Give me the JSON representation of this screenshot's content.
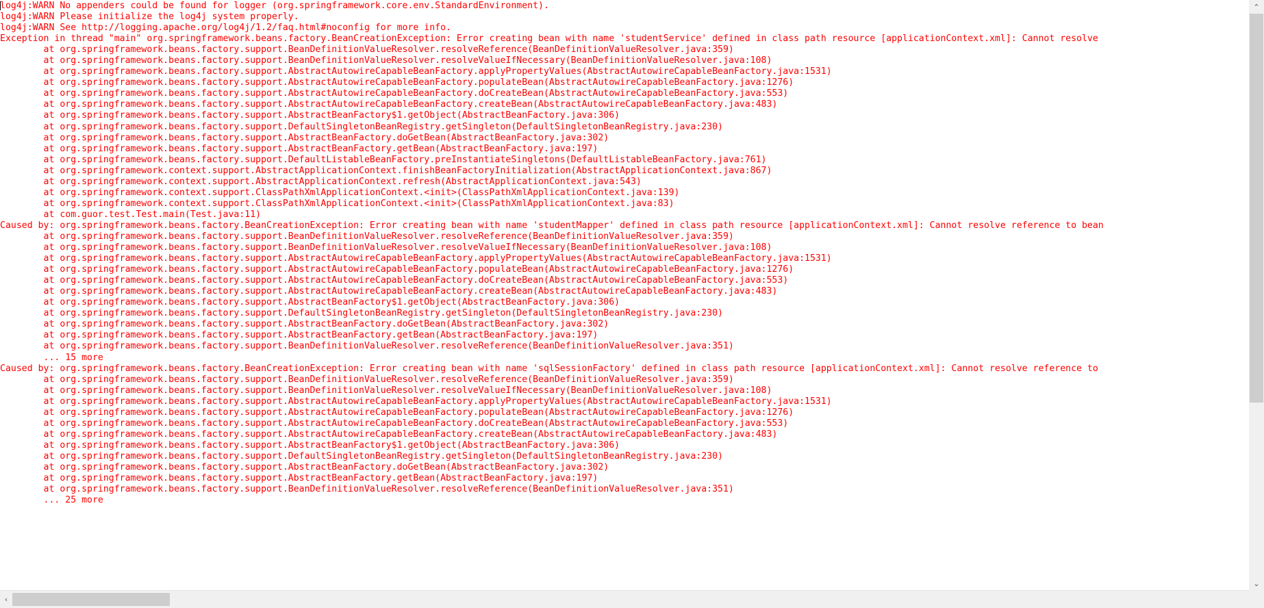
{
  "console": {
    "text_color": "#fe0000",
    "background_color": "#ffffff",
    "lines": [
      "log4j:WARN No appenders could be found for logger (org.springframework.core.env.StandardEnvironment).",
      "log4j:WARN Please initialize the log4j system properly.",
      "log4j:WARN See http://logging.apache.org/log4j/1.2/faq.html#noconfig for more info.",
      "Exception in thread \"main\" org.springframework.beans.factory.BeanCreationException: Error creating bean with name 'studentService' defined in class path resource [applicationContext.xml]: Cannot resolve",
      "\tat org.springframework.beans.factory.support.BeanDefinitionValueResolver.resolveReference(BeanDefinitionValueResolver.java:359)",
      "\tat org.springframework.beans.factory.support.BeanDefinitionValueResolver.resolveValueIfNecessary(BeanDefinitionValueResolver.java:108)",
      "\tat org.springframework.beans.factory.support.AbstractAutowireCapableBeanFactory.applyPropertyValues(AbstractAutowireCapableBeanFactory.java:1531)",
      "\tat org.springframework.beans.factory.support.AbstractAutowireCapableBeanFactory.populateBean(AbstractAutowireCapableBeanFactory.java:1276)",
      "\tat org.springframework.beans.factory.support.AbstractAutowireCapableBeanFactory.doCreateBean(AbstractAutowireCapableBeanFactory.java:553)",
      "\tat org.springframework.beans.factory.support.AbstractAutowireCapableBeanFactory.createBean(AbstractAutowireCapableBeanFactory.java:483)",
      "\tat org.springframework.beans.factory.support.AbstractBeanFactory$1.getObject(AbstractBeanFactory.java:306)",
      "\tat org.springframework.beans.factory.support.DefaultSingletonBeanRegistry.getSingleton(DefaultSingletonBeanRegistry.java:230)",
      "\tat org.springframework.beans.factory.support.AbstractBeanFactory.doGetBean(AbstractBeanFactory.java:302)",
      "\tat org.springframework.beans.factory.support.AbstractBeanFactory.getBean(AbstractBeanFactory.java:197)",
      "\tat org.springframework.beans.factory.support.DefaultListableBeanFactory.preInstantiateSingletons(DefaultListableBeanFactory.java:761)",
      "\tat org.springframework.context.support.AbstractApplicationContext.finishBeanFactoryInitialization(AbstractApplicationContext.java:867)",
      "\tat org.springframework.context.support.AbstractApplicationContext.refresh(AbstractApplicationContext.java:543)",
      "\tat org.springframework.context.support.ClassPathXmlApplicationContext.<init>(ClassPathXmlApplicationContext.java:139)",
      "\tat org.springframework.context.support.ClassPathXmlApplicationContext.<init>(ClassPathXmlApplicationContext.java:83)",
      "\tat com.guor.test.Test.main(Test.java:11)",
      "Caused by: org.springframework.beans.factory.BeanCreationException: Error creating bean with name 'studentMapper' defined in class path resource [applicationContext.xml]: Cannot resolve reference to bean",
      "\tat org.springframework.beans.factory.support.BeanDefinitionValueResolver.resolveReference(BeanDefinitionValueResolver.java:359)",
      "\tat org.springframework.beans.factory.support.BeanDefinitionValueResolver.resolveValueIfNecessary(BeanDefinitionValueResolver.java:108)",
      "\tat org.springframework.beans.factory.support.AbstractAutowireCapableBeanFactory.applyPropertyValues(AbstractAutowireCapableBeanFactory.java:1531)",
      "\tat org.springframework.beans.factory.support.AbstractAutowireCapableBeanFactory.populateBean(AbstractAutowireCapableBeanFactory.java:1276)",
      "\tat org.springframework.beans.factory.support.AbstractAutowireCapableBeanFactory.doCreateBean(AbstractAutowireCapableBeanFactory.java:553)",
      "\tat org.springframework.beans.factory.support.AbstractAutowireCapableBeanFactory.createBean(AbstractAutowireCapableBeanFactory.java:483)",
      "\tat org.springframework.beans.factory.support.AbstractBeanFactory$1.getObject(AbstractBeanFactory.java:306)",
      "\tat org.springframework.beans.factory.support.DefaultSingletonBeanRegistry.getSingleton(DefaultSingletonBeanRegistry.java:230)",
      "\tat org.springframework.beans.factory.support.AbstractBeanFactory.doGetBean(AbstractBeanFactory.java:302)",
      "\tat org.springframework.beans.factory.support.AbstractBeanFactory.getBean(AbstractBeanFactory.java:197)",
      "\tat org.springframework.beans.factory.support.BeanDefinitionValueResolver.resolveReference(BeanDefinitionValueResolver.java:351)",
      "\t... 15 more",
      "Caused by: org.springframework.beans.factory.BeanCreationException: Error creating bean with name 'sqlSessionFactory' defined in class path resource [applicationContext.xml]: Cannot resolve reference to",
      "\tat org.springframework.beans.factory.support.BeanDefinitionValueResolver.resolveReference(BeanDefinitionValueResolver.java:359)",
      "\tat org.springframework.beans.factory.support.BeanDefinitionValueResolver.resolveValueIfNecessary(BeanDefinitionValueResolver.java:108)",
      "\tat org.springframework.beans.factory.support.AbstractAutowireCapableBeanFactory.applyPropertyValues(AbstractAutowireCapableBeanFactory.java:1531)",
      "\tat org.springframework.beans.factory.support.AbstractAutowireCapableBeanFactory.populateBean(AbstractAutowireCapableBeanFactory.java:1276)",
      "\tat org.springframework.beans.factory.support.AbstractAutowireCapableBeanFactory.doCreateBean(AbstractAutowireCapableBeanFactory.java:553)",
      "\tat org.springframework.beans.factory.support.AbstractAutowireCapableBeanFactory.createBean(AbstractAutowireCapableBeanFactory.java:483)",
      "\tat org.springframework.beans.factory.support.AbstractBeanFactory$1.getObject(AbstractBeanFactory.java:306)",
      "\tat org.springframework.beans.factory.support.DefaultSingletonBeanRegistry.getSingleton(DefaultSingletonBeanRegistry.java:230)",
      "\tat org.springframework.beans.factory.support.AbstractBeanFactory.doGetBean(AbstractBeanFactory.java:302)",
      "\tat org.springframework.beans.factory.support.AbstractBeanFactory.getBean(AbstractBeanFactory.java:197)",
      "\tat org.springframework.beans.factory.support.BeanDefinitionValueResolver.resolveReference(BeanDefinitionValueResolver.java:351)",
      "\t... 25 more"
    ]
  },
  "scrollbars": {
    "vertical": {
      "up_arrow_glyph": "⌃",
      "down_arrow_glyph": "⌄",
      "thumb_color": "#cdcdcd",
      "track_color": "#f0f0f0"
    },
    "horizontal": {
      "left_arrow_glyph": "‹",
      "right_arrow_glyph": "›",
      "thumb_color": "#cdcdcd",
      "track_color": "#f0f0f0"
    }
  }
}
